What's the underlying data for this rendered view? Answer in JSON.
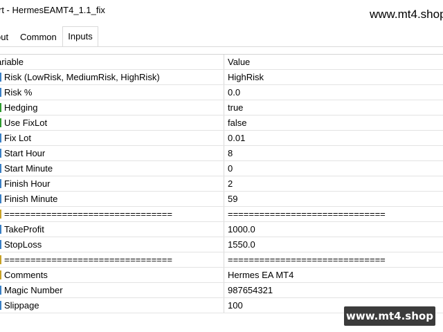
{
  "window": {
    "title": "rt - HermesEAMT4_1.1_fix",
    "watermark_top": "www.mt4.shop"
  },
  "tabs": [
    {
      "label": "out",
      "active": false
    },
    {
      "label": "Common",
      "active": false
    },
    {
      "label": "Inputs",
      "active": true
    }
  ],
  "grid": {
    "columns": [
      "ariable",
      "Value"
    ],
    "rows": [
      {
        "variable": "Risk (LowRisk, MediumRisk, HighRisk)",
        "value": "HighRisk",
        "type": "enum"
      },
      {
        "variable": "Risk %",
        "value": "0.0",
        "type": "number"
      },
      {
        "variable": "Hedging",
        "value": "true",
        "type": "bool"
      },
      {
        "variable": "Use FixLot",
        "value": "false",
        "type": "bool"
      },
      {
        "variable": "Fix Lot",
        "value": "0.01",
        "type": "number"
      },
      {
        "variable": "Start Hour",
        "value": "8",
        "type": "number"
      },
      {
        "variable": "Start Minute",
        "value": "0",
        "type": "number"
      },
      {
        "variable": "Finish Hour",
        "value": "2",
        "type": "number"
      },
      {
        "variable": "Finish Minute",
        "value": "59",
        "type": "number"
      },
      {
        "variable": "================================",
        "value": "==============================",
        "type": "str"
      },
      {
        "variable": "TakeProfit",
        "value": "1000.0",
        "type": "number"
      },
      {
        "variable": "StopLoss",
        "value": "1550.0",
        "type": "number"
      },
      {
        "variable": "================================",
        "value": "==============================",
        "type": "str"
      },
      {
        "variable": "Comments",
        "value": "Hermes EA MT4",
        "type": "str"
      },
      {
        "variable": "Magic Number",
        "value": "987654321",
        "type": "number"
      },
      {
        "variable": "Slippage",
        "value": "100",
        "type": "number"
      }
    ]
  },
  "watermark_badge": "www.mt4.shop"
}
